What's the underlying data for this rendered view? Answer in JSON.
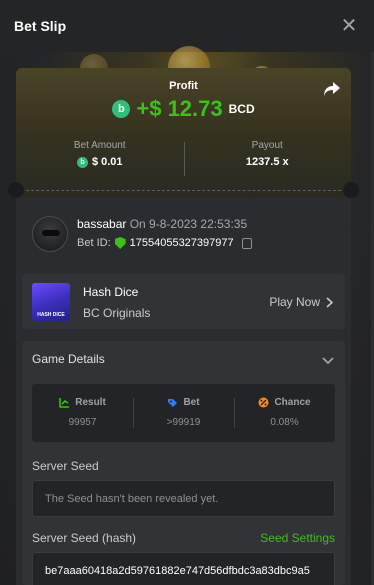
{
  "header": {
    "title": "Bet Slip"
  },
  "profit": {
    "label": "Profit",
    "value": "+$ 12.73",
    "currency": "BCD",
    "coin_glyph": "b"
  },
  "bet_amount": {
    "label": "Bet Amount",
    "value": "$ 0.01"
  },
  "payout": {
    "label": "Payout",
    "value": "1237.5 x"
  },
  "user": {
    "name": "bassabar",
    "on_text": "On 9-8-2023 22:53:35",
    "bet_id_label": "Bet ID:",
    "bet_id": "17554055327397977"
  },
  "game": {
    "name": "Hash Dice",
    "provider": "BC Originals",
    "play_label": "Play Now",
    "thumb_text": "HASH DICE"
  },
  "details": {
    "title": "Game Details",
    "columns": [
      {
        "label": "Result",
        "value": "99957",
        "icon": "result-icon",
        "color": "#3bc117"
      },
      {
        "label": "Bet",
        "value": ">99919",
        "icon": "bet-icon",
        "color": "#2f7bff"
      },
      {
        "label": "Chance",
        "value": "0.08%",
        "icon": "chance-icon",
        "color": "#ff8a1f"
      }
    ],
    "server_seed_label": "Server Seed",
    "server_seed_placeholder": "The Seed hasn't been revealed yet.",
    "server_seed_hash_label": "Server Seed (hash)",
    "seed_settings_label": "Seed Settings",
    "server_seed_hash": "be7aaa60418a2d59761882e747d56dfbdc3a83dbc9a5"
  },
  "colors": {
    "accent_green": "#3bc117",
    "background": "#1a1b1d",
    "panel": "#2a2c2f"
  }
}
